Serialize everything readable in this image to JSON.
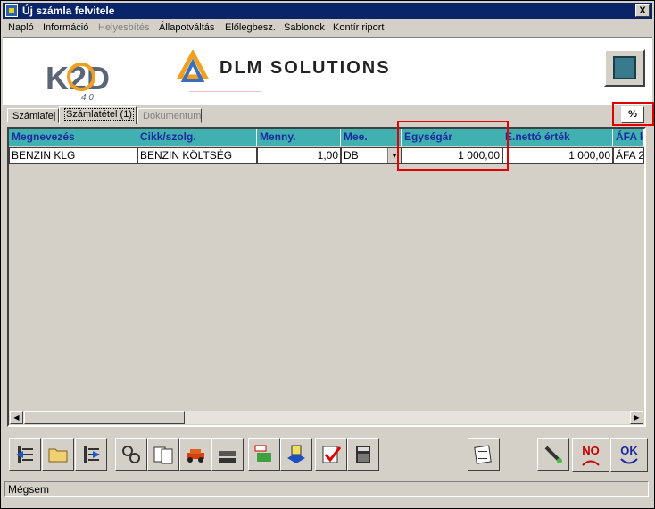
{
  "window": {
    "title": "Új számla felvitele",
    "close_label": "X"
  },
  "menu": [
    {
      "label": "Napló",
      "disabled": false
    },
    {
      "label": "Információ",
      "disabled": false
    },
    {
      "label": "Helyesbítés",
      "disabled": true
    },
    {
      "label": "Állapotváltás",
      "disabled": false
    },
    {
      "label": "Előlegbesz.",
      "disabled": false
    },
    {
      "label": "Sablonok",
      "disabled": false
    },
    {
      "label": "Kontír riport",
      "disabled": false
    }
  ],
  "header": {
    "k2d_logo": "K2D",
    "k2d_version": "4.0",
    "dlm_logo": "DLM SOLUTIONS"
  },
  "tabs": [
    {
      "label": "Számlafej",
      "active": false,
      "disabled": false
    },
    {
      "label": "Számlatétel (1)",
      "active": true,
      "disabled": false
    },
    {
      "label": "Dokumentum",
      "active": false,
      "disabled": true
    }
  ],
  "percent_button": "%",
  "grid": {
    "columns": [
      "Megnevezés",
      "Cikk/szolg.",
      "Menny.",
      "Mee.",
      "Egységár",
      "E.nettó érték",
      "ÁFA k"
    ],
    "rows": [
      [
        "BENZIN KLG",
        "BENZIN KÖLTSÉG",
        "1,00",
        "DB",
        "1 000,00",
        "1 000,00",
        "ÁFA 2"
      ]
    ]
  },
  "toolbar_icons": [
    "list-back-icon",
    "folder-icon",
    "list-forward-icon",
    "gears-icon",
    "documents-icon",
    "car-icon",
    "cars-icon",
    "tax-money-icon",
    "document-stack-icon",
    "checklist-icon",
    "calculator-icon",
    "note-icon",
    "syringe-icon",
    "no-icon",
    "ok-icon"
  ],
  "buttons": {
    "no": "NO",
    "ok": "OK"
  },
  "status": {
    "text": "Mégsem"
  },
  "colors": {
    "title_bar": "#0a246a",
    "grid_header": "#40b0b0",
    "header_text": "#1c2aa0",
    "highlight": "#e00000"
  }
}
